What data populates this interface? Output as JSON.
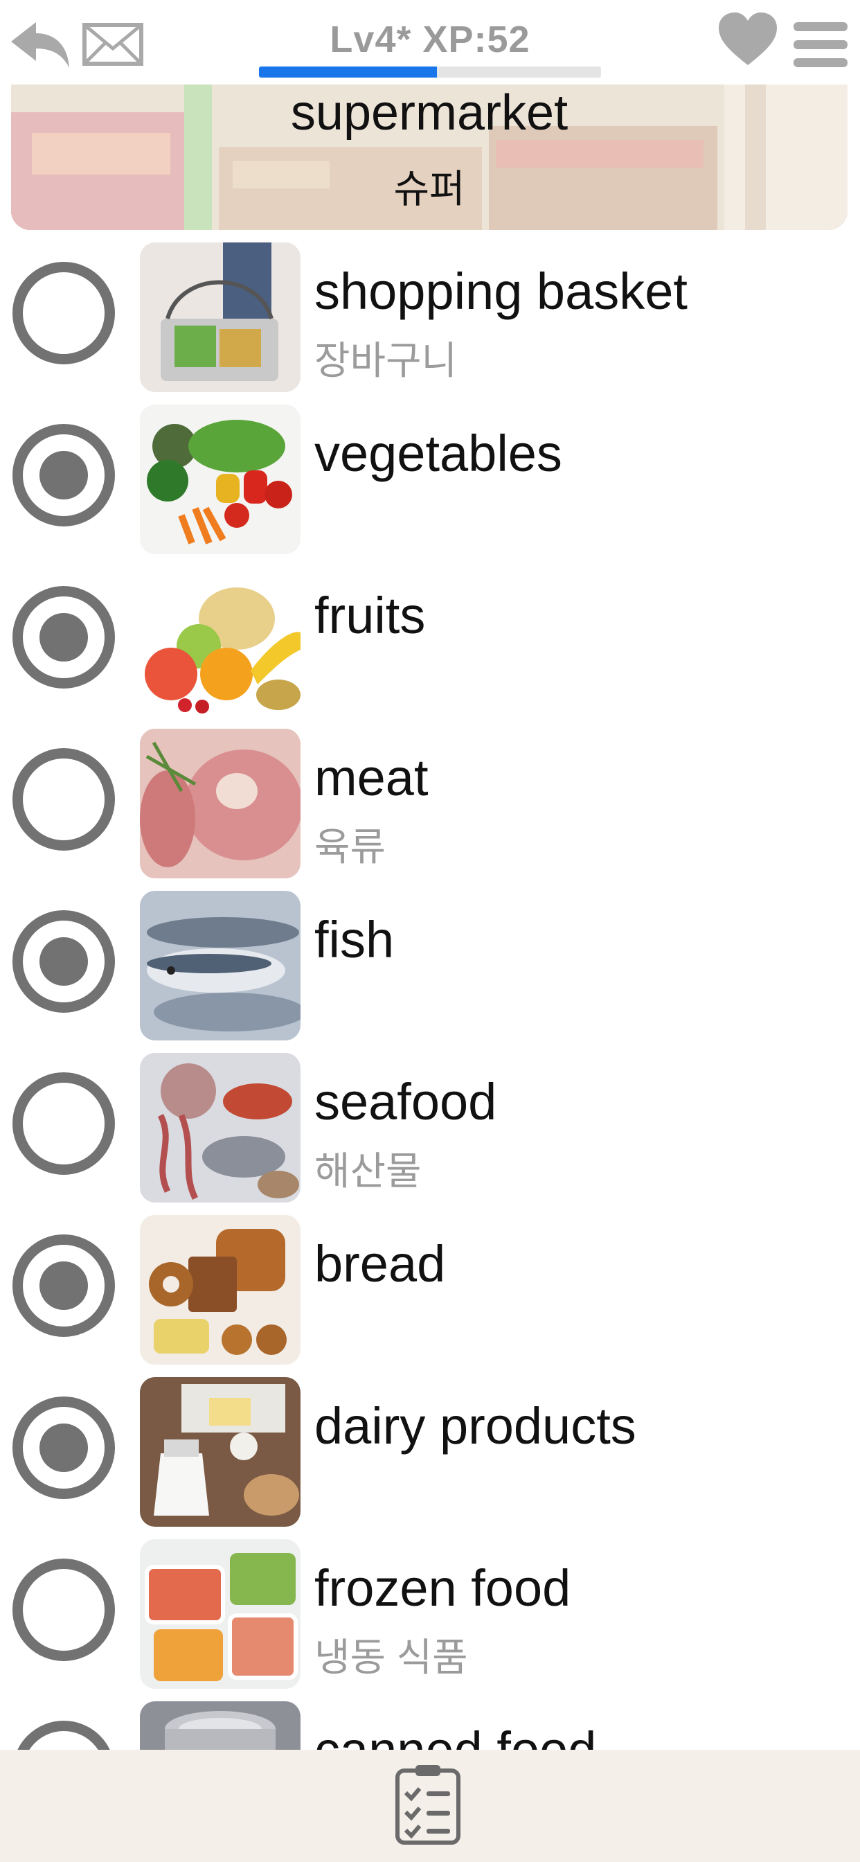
{
  "header": {
    "level_text": "Lv4* XP:52",
    "xp_progress": 0.52,
    "accent_color": "#1976ea",
    "icons": [
      "back-arrow-icon",
      "mail-icon",
      "heart-icon",
      "menu-icon"
    ]
  },
  "category": {
    "title": "supermarket",
    "translation": "슈퍼"
  },
  "items": [
    {
      "word": "shopping basket",
      "translation": "장바구니",
      "selected": false,
      "image": "shopping-basket"
    },
    {
      "word": "vegetables",
      "translation": "",
      "selected": true,
      "image": "vegetables"
    },
    {
      "word": "fruits",
      "translation": "",
      "selected": true,
      "image": "fruits"
    },
    {
      "word": "meat",
      "translation": "육류",
      "selected": false,
      "image": "meat"
    },
    {
      "word": "fish",
      "translation": "",
      "selected": true,
      "image": "fish"
    },
    {
      "word": "seafood",
      "translation": "해산물",
      "selected": false,
      "image": "seafood"
    },
    {
      "word": "bread",
      "translation": "",
      "selected": true,
      "image": "bread"
    },
    {
      "word": "dairy products",
      "translation": "",
      "selected": true,
      "image": "dairy"
    },
    {
      "word": "frozen food",
      "translation": "냉동 식품",
      "selected": false,
      "image": "frozen-food"
    },
    {
      "word": "canned food",
      "translation": "",
      "selected": false,
      "image": "canned-food"
    }
  ],
  "footer": {
    "icon": "checklist-icon"
  }
}
